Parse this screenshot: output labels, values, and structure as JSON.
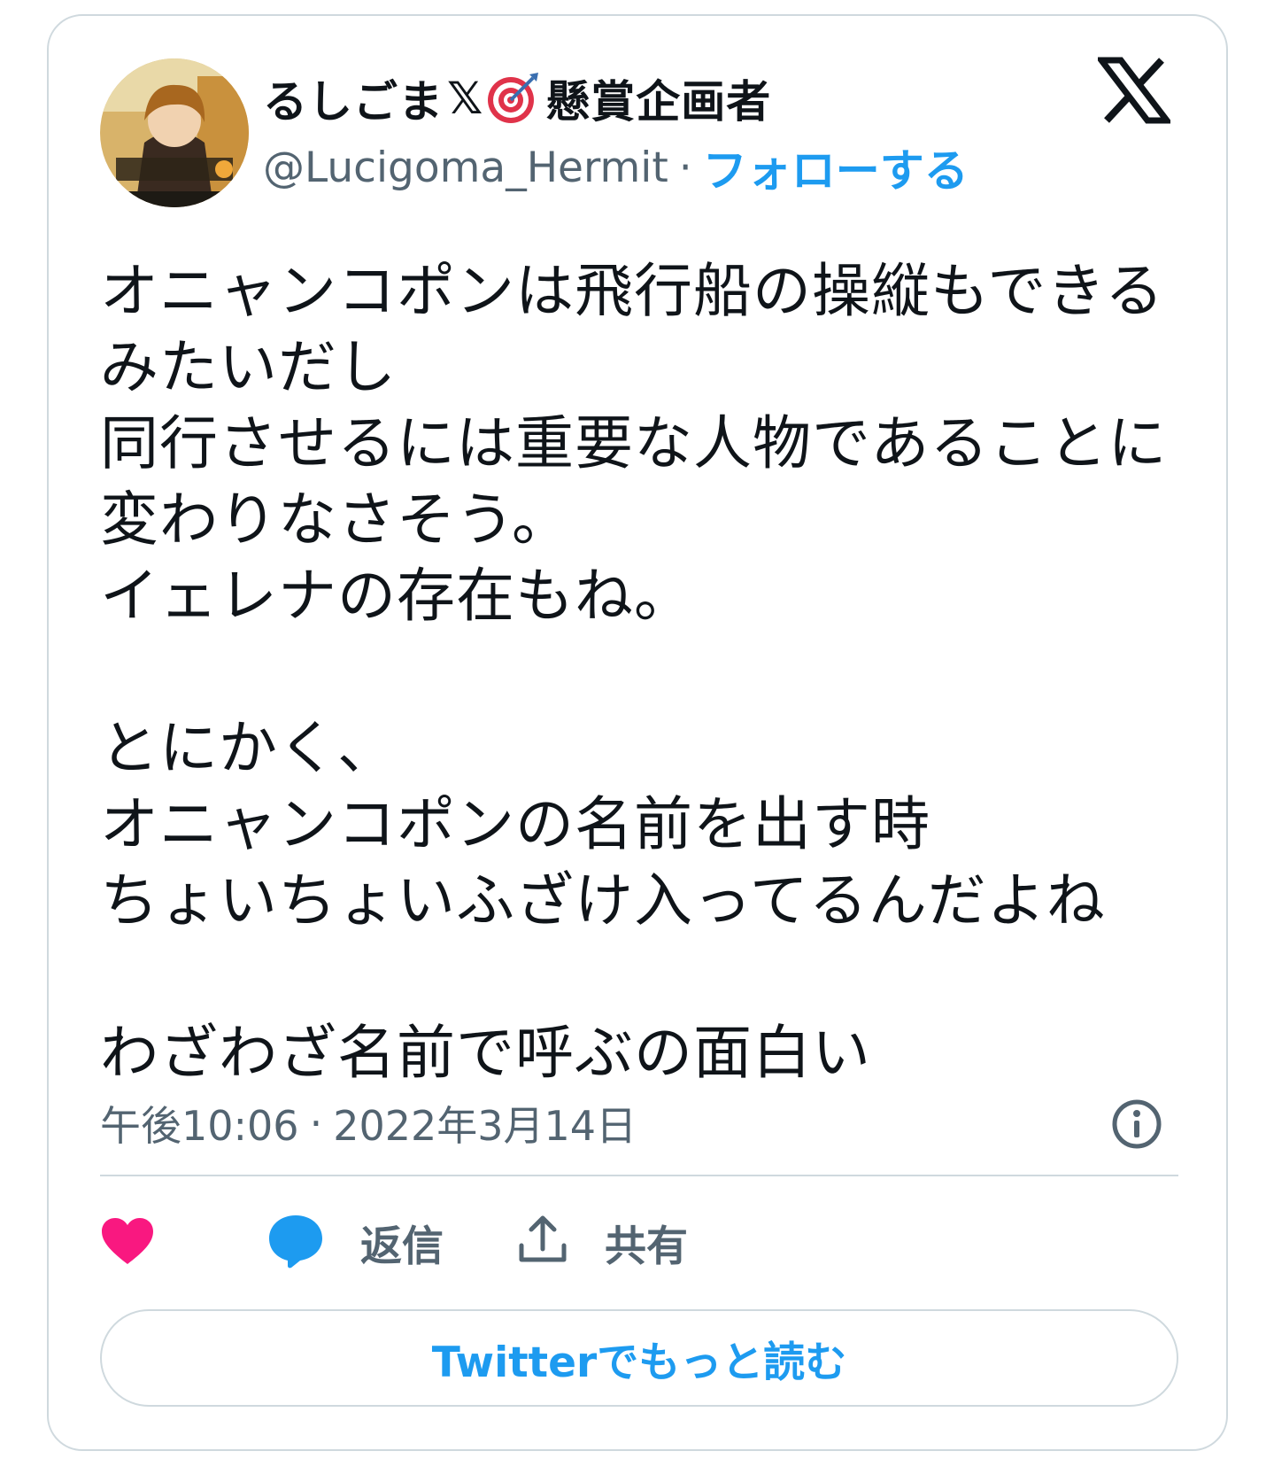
{
  "author": {
    "display_name": "るしごま",
    "display_name_suffix": "懸賞企画者",
    "handle": "@Lucigoma_Hermit",
    "separator": "·",
    "follow_label": "フォローする"
  },
  "icons": {
    "verified_mark": "𝕏",
    "target_emoji": "target-icon",
    "logo": "x-logo-icon",
    "info": "info-icon",
    "like": "heart-icon",
    "reply": "speech-bubble-icon",
    "share": "share-upload-icon"
  },
  "tweet": {
    "text": "オニャンコポンは飛行船の操縦もできるみたいだし\n同行させるには重要な人物であることに変わりなさそう。\nイェレナの存在もね。\n\nとにかく、\nオニャンコポンの名前を出す時\nちょいちょいふざけ入ってるんだよね\n\nわざわざ名前で呼ぶの面白い"
  },
  "meta": {
    "time": "午後10:06",
    "separator": "·",
    "date": "2022年3月14日"
  },
  "actions": {
    "reply_label": "返信",
    "share_label": "共有"
  },
  "footer": {
    "read_more_label": "Twitterでもっと読む"
  },
  "colors": {
    "accent": "#1d9bf0",
    "like": "#f91880",
    "secondary_text": "#536471",
    "border": "#cfd9de"
  }
}
